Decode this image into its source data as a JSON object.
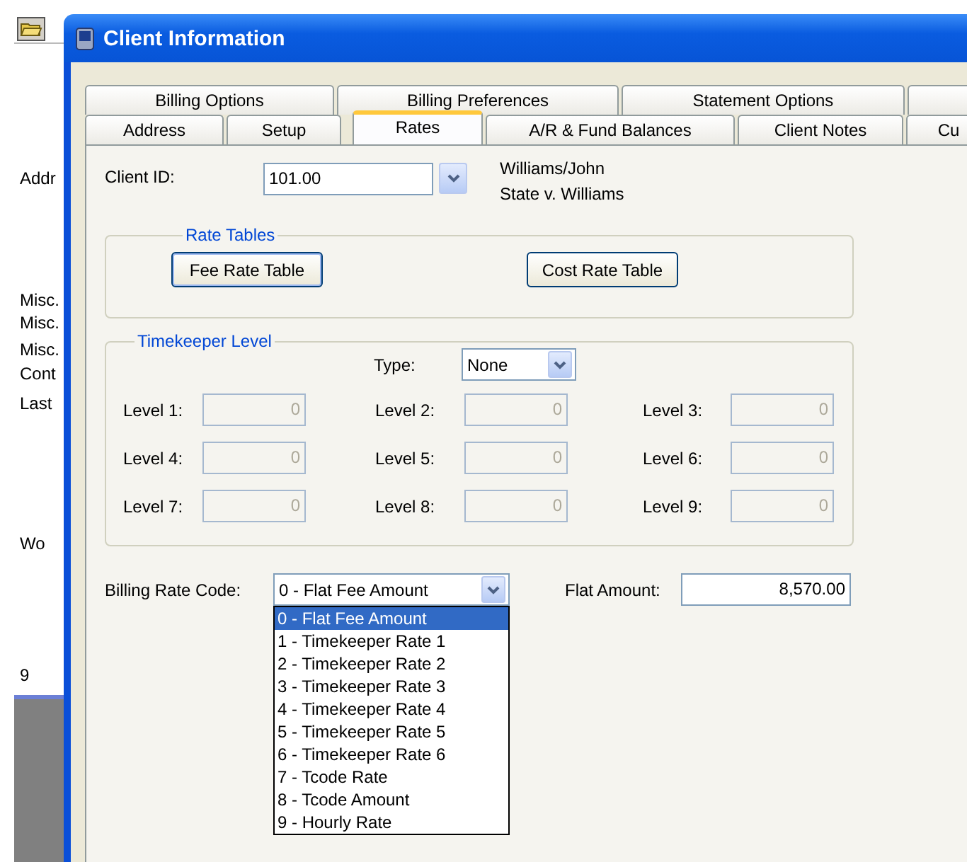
{
  "background_window": {
    "labels": [
      "Addr",
      "Misc.",
      "Misc.",
      "Misc.",
      "Cont",
      "Last",
      "Wo",
      "9"
    ]
  },
  "dialog": {
    "title": "Client Information",
    "tab_rows": [
      [
        {
          "label": "Billing Options",
          "selected": false
        },
        {
          "label": "Billing Preferences",
          "selected": false
        },
        {
          "label": "Statement Options",
          "selected": false
        }
      ],
      [
        {
          "label": "Address",
          "selected": false
        },
        {
          "label": "Setup",
          "selected": false
        },
        {
          "label": "Rates",
          "selected": true
        },
        {
          "label": "A/R & Fund Balances",
          "selected": false
        },
        {
          "label": "Client Notes",
          "selected": false
        },
        {
          "label": "Cu",
          "selected": false
        }
      ]
    ],
    "client_id": {
      "label": "Client ID:",
      "value": "101.00"
    },
    "client_names": [
      "Williams/John",
      "State v. Williams"
    ],
    "rate_tables": {
      "title": "Rate Tables",
      "buttons": [
        "Fee Rate Table",
        "Cost Rate Table"
      ]
    },
    "timekeeper_level": {
      "title": "Timekeeper Level",
      "type": {
        "label": "Type:",
        "value": "None"
      },
      "levels": [
        {
          "label": "Level 1:",
          "value": "0"
        },
        {
          "label": "Level 2:",
          "value": "0"
        },
        {
          "label": "Level 3:",
          "value": "0"
        },
        {
          "label": "Level 4:",
          "value": "0"
        },
        {
          "label": "Level 5:",
          "value": "0"
        },
        {
          "label": "Level 6:",
          "value": "0"
        },
        {
          "label": "Level 7:",
          "value": "0"
        },
        {
          "label": "Level 8:",
          "value": "0"
        },
        {
          "label": "Level 9:",
          "value": "0"
        }
      ]
    },
    "billing_rate_code": {
      "label": "Billing Rate Code:",
      "value": "0 - Flat Fee Amount",
      "expanded": true,
      "options": [
        {
          "label": "0 - Flat Fee Amount",
          "selected": true
        },
        {
          "label": "1 - Timekeeper Rate 1",
          "selected": false
        },
        {
          "label": "2 - Timekeeper Rate 2",
          "selected": false
        },
        {
          "label": "3 - Timekeeper Rate 3",
          "selected": false
        },
        {
          "label": "4 - Timekeeper Rate 4",
          "selected": false
        },
        {
          "label": "5 - Timekeeper Rate 5",
          "selected": false
        },
        {
          "label": "6 - Timekeeper Rate 6",
          "selected": false
        },
        {
          "label": "7 - Tcode Rate",
          "selected": false
        },
        {
          "label": "8 - Tcode Amount",
          "selected": false
        },
        {
          "label": "9 - Hourly Rate",
          "selected": false
        }
      ]
    },
    "flat_amount": {
      "label": "Flat Amount:",
      "value": "8,570.00"
    }
  }
}
